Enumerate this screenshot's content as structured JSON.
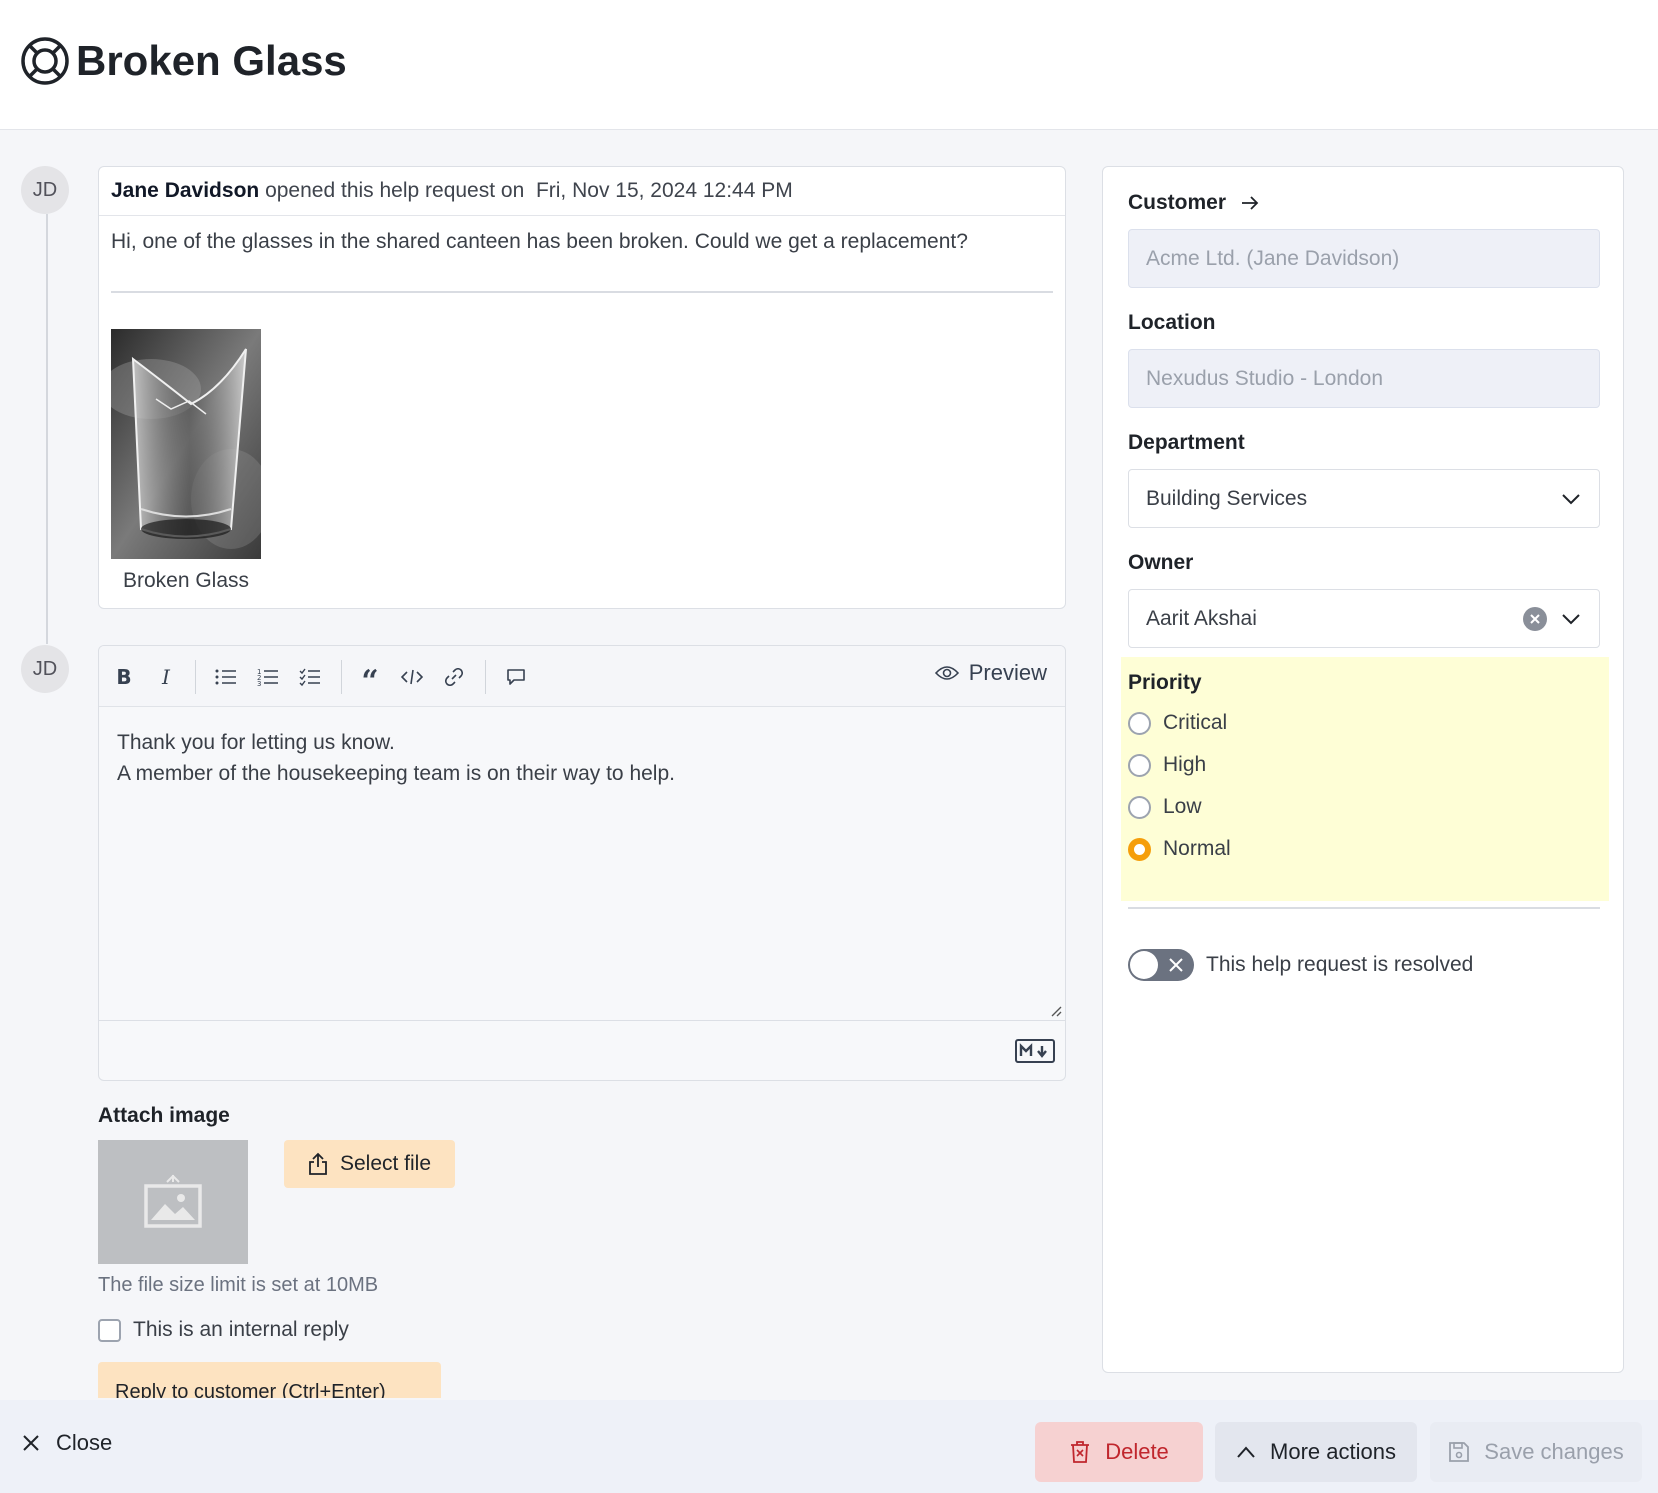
{
  "header": {
    "title": "Broken Glass",
    "icon": "lifebuoy-icon"
  },
  "thread": {
    "opener": {
      "avatar_initials": "JD",
      "author": "Jane Davidson",
      "action_text": " opened this help request on  ",
      "date": "Fri, Nov 15, 2024 12:44 PM",
      "message": "Hi, one of the glasses in the shared canteen has been broken. Could we get a replacement?",
      "attachment_caption": "Broken Glass"
    },
    "reply": {
      "avatar_initials": "JD"
    }
  },
  "editor": {
    "toolbar": [
      "bold-icon",
      "italic-icon",
      "bullet-list-icon",
      "numbered-list-icon",
      "checklist-icon",
      "quote-icon",
      "code-icon",
      "link-icon",
      "comment-icon"
    ],
    "preview_label": "Preview",
    "line1": "Thank you for letting us know.",
    "line2": "A member of the housekeeping team is on their way to help."
  },
  "attach": {
    "label": "Attach image",
    "select_file_label": "Select file",
    "size_hint": "The file size limit is set at 10MB",
    "internal_reply_label": "This is an internal reply",
    "reply_button_label": "Reply to customer (Ctrl+Enter)"
  },
  "panel": {
    "customer": {
      "label": "Customer",
      "value": "Acme Ltd. (Jane Davidson)"
    },
    "location": {
      "label": "Location",
      "value": "Nexudus Studio - London"
    },
    "department": {
      "label": "Department",
      "value": "Building Services"
    },
    "owner": {
      "label": "Owner",
      "value": "Aarit Akshai"
    },
    "priority": {
      "label": "Priority",
      "options": [
        "Critical",
        "High",
        "Low",
        "Normal"
      ],
      "selected": "Normal"
    },
    "resolved_label": "This help request is resolved",
    "resolved": false
  },
  "footer": {
    "close_label": "Close",
    "delete_label": "Delete",
    "more_actions_label": "More actions",
    "save_label": "Save changes"
  },
  "colors": {
    "accent_orange": "#f59e0b",
    "priority_bg": "#fefed6",
    "button_peach": "#fde3c1",
    "delete_bg": "#f6d1d1",
    "delete_text": "#c0262d"
  }
}
